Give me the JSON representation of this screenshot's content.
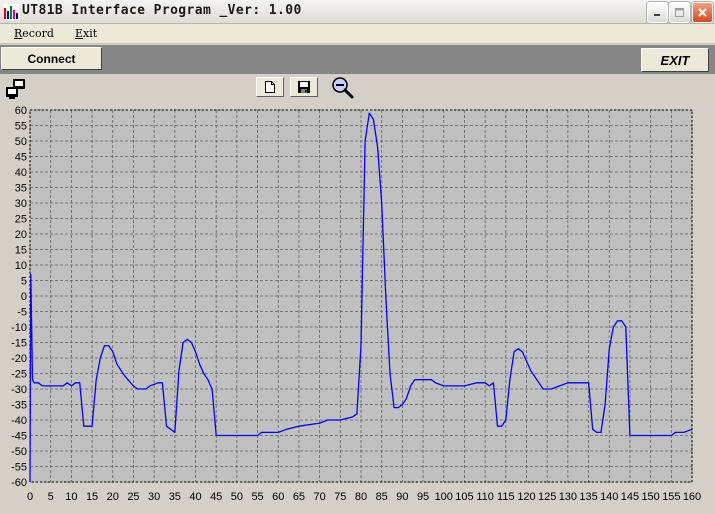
{
  "window": {
    "title": "UT81B Interface Program _Ver: 1.00"
  },
  "menu": {
    "record_acc": "R",
    "record_rest": "ecord",
    "exit_acc": "E",
    "exit_rest": "xit"
  },
  "toolbar": {
    "connect_label": "Connect",
    "exit_label": "EXIT"
  },
  "icons": {
    "app": "app-icon",
    "monitor": "monitor-icon",
    "new": "new-document-icon",
    "save": "floppy-disk-icon",
    "zoom": "zoom-out-icon"
  },
  "colors": {
    "plot_background": "#c0c0c0",
    "trace": "#0000ff",
    "grid": "#606060"
  },
  "chart_data": {
    "type": "line",
    "xlim": [
      0,
      160
    ],
    "ylim": [
      -60,
      60
    ],
    "x_ticks": [
      0,
      5,
      10,
      15,
      20,
      25,
      30,
      35,
      40,
      45,
      50,
      55,
      60,
      65,
      70,
      75,
      80,
      85,
      90,
      95,
      100,
      105,
      110,
      115,
      120,
      125,
      130,
      135,
      140,
      145,
      150,
      155,
      160
    ],
    "y_ticks": [
      60,
      55,
      50,
      45,
      40,
      35,
      30,
      25,
      20,
      15,
      10,
      5,
      0,
      -5,
      -10,
      -15,
      -20,
      -25,
      -30,
      -35,
      -40,
      -45,
      -50,
      -55,
      -60
    ],
    "grid": true,
    "series": [
      {
        "points": [
          [
            0,
            -60
          ],
          [
            0.2,
            7
          ],
          [
            0.6,
            -27
          ],
          [
            1,
            -28
          ],
          [
            2,
            -28
          ],
          [
            3,
            -29
          ],
          [
            5,
            -29
          ],
          [
            8,
            -29
          ],
          [
            9,
            -28
          ],
          [
            10,
            -29
          ],
          [
            11,
            -28
          ],
          [
            12,
            -28
          ],
          [
            13,
            -42
          ],
          [
            15,
            -42
          ],
          [
            16,
            -27
          ],
          [
            17,
            -20
          ],
          [
            18,
            -16
          ],
          [
            19,
            -16
          ],
          [
            20,
            -18
          ],
          [
            21,
            -22
          ],
          [
            23,
            -26
          ],
          [
            25,
            -29
          ],
          [
            26,
            -30
          ],
          [
            28,
            -30
          ],
          [
            29,
            -29
          ],
          [
            31,
            -28
          ],
          [
            32,
            -28
          ],
          [
            33,
            -42
          ],
          [
            35,
            -44
          ],
          [
            36,
            -24
          ],
          [
            37,
            -15
          ],
          [
            38,
            -14
          ],
          [
            39,
            -15
          ],
          [
            40,
            -18
          ],
          [
            41,
            -22
          ],
          [
            42,
            -25
          ],
          [
            43,
            -27
          ],
          [
            44,
            -30
          ],
          [
            45,
            -45
          ],
          [
            50,
            -45
          ],
          [
            55,
            -45
          ],
          [
            56,
            -44
          ],
          [
            60,
            -44
          ],
          [
            62,
            -43
          ],
          [
            65,
            -42
          ],
          [
            70,
            -41
          ],
          [
            72,
            -40
          ],
          [
            75,
            -40
          ],
          [
            78,
            -39
          ],
          [
            79,
            -38
          ],
          [
            80,
            -16
          ],
          [
            81,
            50
          ],
          [
            82,
            59
          ],
          [
            83,
            57
          ],
          [
            84,
            48
          ],
          [
            85,
            30
          ],
          [
            86,
            0
          ],
          [
            87,
            -25
          ],
          [
            88,
            -36
          ],
          [
            89,
            -36
          ],
          [
            90,
            -35
          ],
          [
            91,
            -33
          ],
          [
            92,
            -29
          ],
          [
            93,
            -27
          ],
          [
            95,
            -27
          ],
          [
            97,
            -27
          ],
          [
            98,
            -28
          ],
          [
            100,
            -29
          ],
          [
            105,
            -29
          ],
          [
            108,
            -28
          ],
          [
            110,
            -28
          ],
          [
            111,
            -29
          ],
          [
            112,
            -28
          ],
          [
            113,
            -42
          ],
          [
            114,
            -42
          ],
          [
            115,
            -40
          ],
          [
            116,
            -27
          ],
          [
            117,
            -18
          ],
          [
            118,
            -17
          ],
          [
            119,
            -18
          ],
          [
            120,
            -21
          ],
          [
            121,
            -24
          ],
          [
            122,
            -26
          ],
          [
            123,
            -28
          ],
          [
            124,
            -30
          ],
          [
            126,
            -30
          ],
          [
            128,
            -29
          ],
          [
            130,
            -28
          ],
          [
            133,
            -28
          ],
          [
            135,
            -28
          ],
          [
            136,
            -43
          ],
          [
            137,
            -44
          ],
          [
            138,
            -44
          ],
          [
            139,
            -35
          ],
          [
            140,
            -17
          ],
          [
            141,
            -10
          ],
          [
            142,
            -8
          ],
          [
            143,
            -8
          ],
          [
            144,
            -10
          ],
          [
            145,
            -45
          ],
          [
            150,
            -45
          ],
          [
            155,
            -45
          ],
          [
            156,
            -44
          ],
          [
            158,
            -44
          ],
          [
            160,
            -43
          ]
        ]
      }
    ]
  }
}
